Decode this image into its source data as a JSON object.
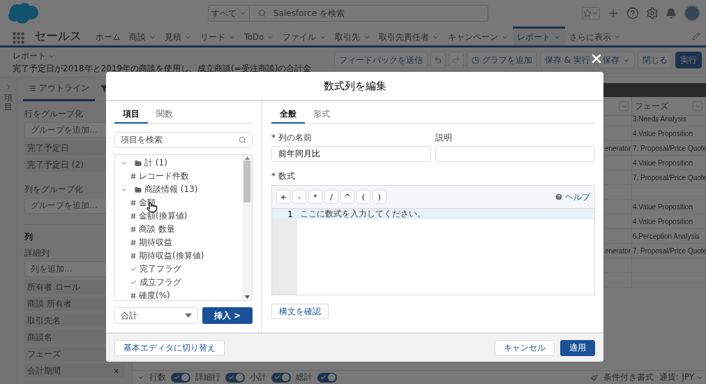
{
  "header": {
    "search_scope": "すべて",
    "search_placeholder": "Salesforce を検索"
  },
  "nav": {
    "app_name": "セールス",
    "items": [
      {
        "label": "ホーム",
        "has_menu": false,
        "selected": false
      },
      {
        "label": "商談",
        "has_menu": true,
        "selected": false
      },
      {
        "label": "見積",
        "has_menu": true,
        "selected": false
      },
      {
        "label": "リード",
        "has_menu": true,
        "selected": false
      },
      {
        "label": "ToDo",
        "has_menu": true,
        "selected": false
      },
      {
        "label": "ファイル",
        "has_menu": true,
        "selected": false
      },
      {
        "label": "取引先",
        "has_menu": true,
        "selected": false
      },
      {
        "label": "取引先責任者",
        "has_menu": true,
        "selected": false
      },
      {
        "label": "キャンペーン",
        "has_menu": true,
        "selected": false
      },
      {
        "label": "レポート",
        "has_menu": true,
        "selected": true
      }
    ],
    "more": "さらに表示"
  },
  "report": {
    "breadcrumb": "レポート",
    "title": "完了予定日が2018年と2019年の商談を使用し、成立商談(=受注商談)の合計金",
    "buttons": [
      {
        "kind": "text",
        "label": "フィードバックを送信"
      },
      {
        "kind": "undo"
      },
      {
        "kind": "redo"
      },
      {
        "kind": "chart",
        "label": "グラフを追加"
      },
      {
        "kind": "text",
        "label": "保存 & 実行"
      },
      {
        "kind": "menu",
        "label": "保存"
      },
      {
        "kind": "text",
        "label": "閉じる"
      },
      {
        "kind": "primary",
        "label": "実行"
      }
    ]
  },
  "sidebar": {
    "collapsed_label": "項目",
    "tabs": [
      {
        "kind": "outline",
        "label": "アウトライン",
        "selected": true
      },
      {
        "kind": "filter",
        "selected": false
      }
    ],
    "group_rows": {
      "title": "行をグループ化",
      "add_placeholder": "グループを追加...",
      "items": [
        "完了予定日",
        "完了予定日 (2)"
      ]
    },
    "group_columns": {
      "title": "列をグループ化",
      "add_placeholder": "グループを追加..."
    },
    "columns": {
      "heading": "列",
      "subtitle": "詳細列",
      "add_placeholder": "列を追加...",
      "items": [
        {
          "label": "所有者 ロール"
        },
        {
          "label": "商談 所有者"
        },
        {
          "label": "取引先名"
        },
        {
          "label": "商談名"
        },
        {
          "label": "フェーズ"
        },
        {
          "label": "会計期間",
          "removable": true
        }
      ]
    }
  },
  "table": {
    "phase_header": "フェーズ",
    "rows": [
      {
        "phase": "3.Needs Analysis"
      },
      {
        "phase": "4.Value Proposition"
      },
      {
        "column_1": "enerator",
        "phase": "7. Proposal/Price Quote"
      },
      {
        "phase": "4.Value Proposition"
      },
      {
        "phase": "7. Proposal/Price Quote"
      },
      {},
      {
        "phase": "4.Value Proposition"
      },
      {
        "phase": "4.Value Proposition"
      },
      {
        "phase": "6.Perception Analysis"
      },
      {
        "column_1": "enerator",
        "phase": "7. Proposal/Price Quote"
      }
    ]
  },
  "bottom_bar": {
    "toggles": [
      {
        "label": "行数",
        "on": true
      },
      {
        "label": "詳細行",
        "on": true
      },
      {
        "label": "小計",
        "on": true
      },
      {
        "label": "総計",
        "on": true
      }
    ],
    "conditional_format": "条件付き書式",
    "currency": "通貨: JPY"
  },
  "modal": {
    "title": "数式列を編集",
    "left_tabs": [
      {
        "label": "項目",
        "selected": true
      },
      {
        "label": "関数",
        "selected": false
      }
    ],
    "search_placeholder": "項目を検索",
    "tree": [
      {
        "label": "計 (1)",
        "expanded": true,
        "children": [
          {
            "label": "レコード件数",
            "kind": "number"
          }
        ]
      },
      {
        "label": "商談情報 (13)",
        "expanded": true,
        "children": [
          {
            "label": "金額",
            "kind": "number"
          },
          {
            "label": "金額(換算値)",
            "kind": "number"
          },
          {
            "label": "商談 数量",
            "kind": "number"
          },
          {
            "label": "期待収益",
            "kind": "number"
          },
          {
            "label": "期待収益(換算値)",
            "kind": "number"
          },
          {
            "label": "完了フラグ",
            "kind": "checkbox"
          },
          {
            "label": "成立フラグ",
            "kind": "checkbox"
          },
          {
            "label": "確度(%)",
            "kind": "number"
          }
        ]
      }
    ],
    "aggregate": "合計",
    "insert_button": "挿入 >",
    "right_tabs": [
      {
        "label": "全般",
        "selected": true
      },
      {
        "label": "形式",
        "selected": false
      }
    ],
    "name_label": "* 列の名前",
    "name_value": "前年同月比",
    "description_label": "説明",
    "formula_label": "* 数式",
    "operators": [
      "+",
      "-",
      "*",
      "/",
      "^",
      "(",
      ")"
    ],
    "help": "ヘルプ",
    "editor_lines": [
      {
        "number": "1",
        "placeholder": "ここに数式を入力してください。"
      }
    ],
    "check_syntax": "構文を確認",
    "switch_editor": "基本エディタに切り替え",
    "cancel": "キャンセル",
    "apply": "適用"
  }
}
